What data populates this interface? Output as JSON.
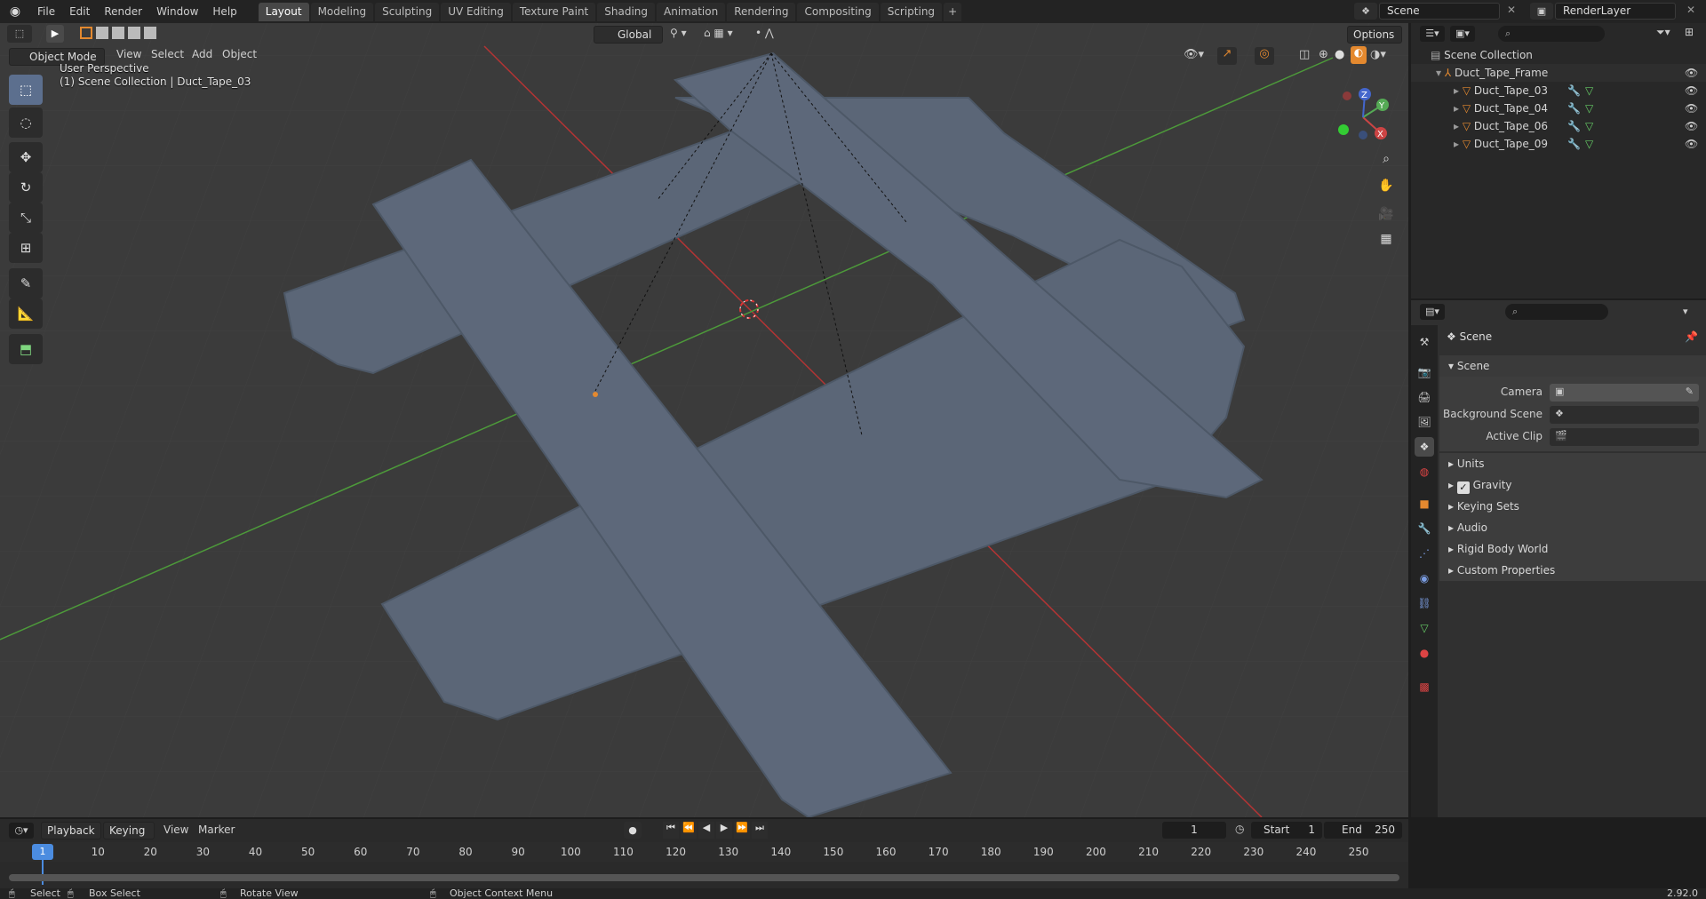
{
  "topbar": {
    "menus": [
      "File",
      "Edit",
      "Render",
      "Window",
      "Help"
    ],
    "workspace_tabs": [
      "Layout",
      "Modeling",
      "Sculpting",
      "UV Editing",
      "Texture Paint",
      "Shading",
      "Animation",
      "Rendering",
      "Compositing",
      "Scripting"
    ],
    "active_tab": "Layout",
    "add_tab": "+",
    "scene_name": "Scene",
    "render_layer": "RenderLayer"
  },
  "viewport": {
    "mode": "Object Mode",
    "menus": [
      "View",
      "Select",
      "Add",
      "Object"
    ],
    "orientation": "Global",
    "options_label": "Options",
    "overlay_line1": "User Perspective",
    "overlay_line2": "(1) Scene Collection | Duct_Tape_03",
    "gizmo_axes": {
      "x": "X",
      "y": "Y",
      "z": "Z"
    }
  },
  "toolbar": {
    "tools": [
      "select-box-icon",
      "cursor-icon",
      "move-icon",
      "rotate-icon",
      "scale-icon",
      "transform-icon",
      "annotate-icon",
      "measure-icon",
      "add-cube-icon"
    ]
  },
  "outliner": {
    "root": "Scene Collection",
    "parent": "Duct_Tape_Frame",
    "children": [
      "Duct_Tape_03",
      "Duct_Tape_04",
      "Duct_Tape_06",
      "Duct_Tape_09"
    ]
  },
  "properties": {
    "header": "Scene",
    "section": "Scene",
    "fields": [
      {
        "label": "Camera"
      },
      {
        "label": "Background Scene"
      },
      {
        "label": "Active Clip"
      }
    ],
    "panels": [
      "Units",
      "Gravity",
      "Keying Sets",
      "Audio",
      "Rigid Body World",
      "Custom Properties"
    ],
    "gravity_checked": true
  },
  "timeline": {
    "menus": [
      "Playback",
      "Keying",
      "View",
      "Marker"
    ],
    "current_frame": "1",
    "start_label": "Start",
    "start_value": "1",
    "end_label": "End",
    "end_value": "250",
    "ruler": [
      "1",
      "10",
      "20",
      "30",
      "40",
      "50",
      "60",
      "70",
      "80",
      "90",
      "100",
      "110",
      "120",
      "130",
      "140",
      "150",
      "160",
      "170",
      "180",
      "190",
      "200",
      "210",
      "220",
      "230",
      "240",
      "250"
    ],
    "cursor_frame": "1"
  },
  "statusbar": {
    "select": "Select",
    "box_select": "Box Select",
    "rotate_view": "Rotate View",
    "context_menu": "Object Context Menu",
    "version": "2.92.0"
  },
  "colors": {
    "accent": "#e4892f",
    "active_tool": "#5c6f8e",
    "tape": "#5b6677",
    "x_axis": "#b43434",
    "y_axis": "#4d9a3a"
  }
}
